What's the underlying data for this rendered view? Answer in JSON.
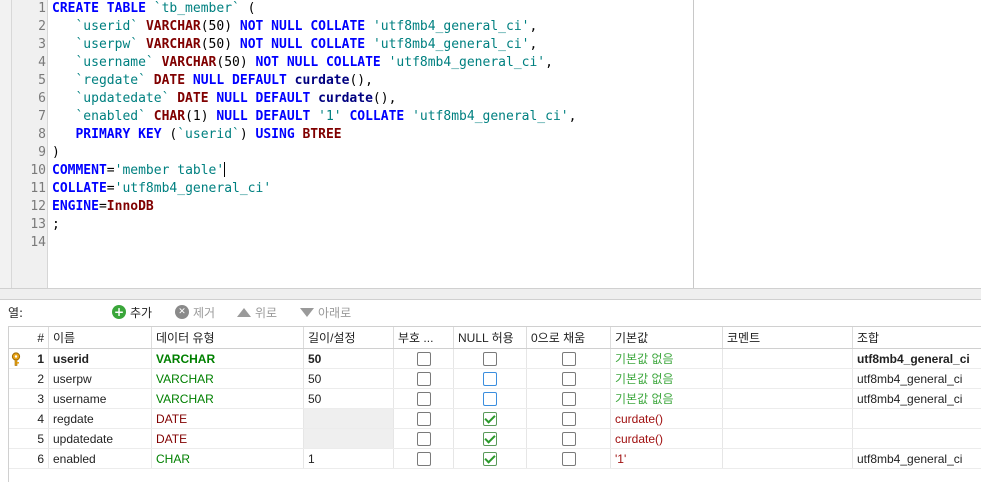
{
  "editor": {
    "line_numbers": [
      "1",
      "2",
      "3",
      "4",
      "5",
      "6",
      "7",
      "8",
      "9",
      "10",
      "11",
      "12",
      "13",
      "14"
    ],
    "lines": [
      [
        [
          "kw",
          "CREATE TABLE "
        ],
        [
          "id",
          "`tb_member`"
        ],
        [
          "pu",
          " ("
        ]
      ],
      [
        [
          "pu",
          "   "
        ],
        [
          "id",
          "`userid`"
        ],
        [
          "pu",
          " "
        ],
        [
          "ty",
          "VARCHAR"
        ],
        [
          "pu",
          "(50) "
        ],
        [
          "kw",
          "NOT NULL COLLATE "
        ],
        [
          "st",
          "'utf8mb4_general_ci'"
        ],
        [
          "pu",
          ","
        ]
      ],
      [
        [
          "pu",
          "   "
        ],
        [
          "id",
          "`userpw`"
        ],
        [
          "pu",
          " "
        ],
        [
          "ty",
          "VARCHAR"
        ],
        [
          "pu",
          "(50) "
        ],
        [
          "kw",
          "NOT NULL COLLATE "
        ],
        [
          "st",
          "'utf8mb4_general_ci'"
        ],
        [
          "pu",
          ","
        ]
      ],
      [
        [
          "pu",
          "   "
        ],
        [
          "id",
          "`username`"
        ],
        [
          "pu",
          " "
        ],
        [
          "ty",
          "VARCHAR"
        ],
        [
          "pu",
          "(50) "
        ],
        [
          "kw",
          "NOT NULL COLLATE "
        ],
        [
          "st",
          "'utf8mb4_general_ci'"
        ],
        [
          "pu",
          ","
        ]
      ],
      [
        [
          "pu",
          "   "
        ],
        [
          "id",
          "`regdate`"
        ],
        [
          "pu",
          " "
        ],
        [
          "ty",
          "DATE"
        ],
        [
          "pu",
          " "
        ],
        [
          "kw",
          "NULL DEFAULT "
        ],
        [
          "fn",
          "curdate"
        ],
        [
          "pu",
          "(),"
        ]
      ],
      [
        [
          "pu",
          "   "
        ],
        [
          "id",
          "`updatedate`"
        ],
        [
          "pu",
          " "
        ],
        [
          "ty",
          "DATE"
        ],
        [
          "pu",
          " "
        ],
        [
          "kw",
          "NULL DEFAULT "
        ],
        [
          "fn",
          "curdate"
        ],
        [
          "pu",
          "(),"
        ]
      ],
      [
        [
          "pu",
          "   "
        ],
        [
          "id",
          "`enabled`"
        ],
        [
          "pu",
          " "
        ],
        [
          "ty",
          "CHAR"
        ],
        [
          "pu",
          "(1) "
        ],
        [
          "kw",
          "NULL DEFAULT "
        ],
        [
          "st",
          "'1'"
        ],
        [
          "pu",
          " "
        ],
        [
          "kw",
          "COLLATE "
        ],
        [
          "st",
          "'utf8mb4_general_ci'"
        ],
        [
          "pu",
          ","
        ]
      ],
      [
        [
          "pu",
          "   "
        ],
        [
          "kw",
          "PRIMARY KEY"
        ],
        [
          "pu",
          " ("
        ],
        [
          "id",
          "`userid`"
        ],
        [
          "pu",
          ") "
        ],
        [
          "kw",
          "USING "
        ],
        [
          "ty",
          "BTREE"
        ]
      ],
      [
        [
          "pu",
          ")"
        ]
      ],
      [
        [
          "kw",
          "COMMENT"
        ],
        [
          "pu",
          "="
        ],
        [
          "st",
          "'member table'"
        ],
        [
          "caret",
          ""
        ]
      ],
      [
        [
          "kw",
          "COLLATE"
        ],
        [
          "pu",
          "="
        ],
        [
          "st",
          "'utf8mb4_general_ci'"
        ]
      ],
      [
        [
          "kw",
          "ENGINE"
        ],
        [
          "pu",
          "="
        ],
        [
          "ty",
          "InnoDB"
        ]
      ],
      [
        [
          "pu",
          ";"
        ]
      ],
      [
        [
          "pu",
          ""
        ]
      ]
    ]
  },
  "toolbar": {
    "columns_label": "열:",
    "add_label": "추가",
    "remove_label": "제거",
    "up_label": "위로",
    "down_label": "아래로"
  },
  "grid": {
    "headers": {
      "num": "#",
      "name": "이름",
      "datatype": "데이터 유형",
      "length": "길이/설정",
      "unsigned": "부호 ...",
      "allow_null": "NULL 허용",
      "zerofill": "0으로 채움",
      "default": "기본값",
      "comment": "코멘트",
      "collation": "조합"
    },
    "rows": [
      {
        "num": "1",
        "name": "userid",
        "type": "VARCHAR",
        "length": "50",
        "unsigned": false,
        "allow_null": false,
        "zerofill": false,
        "default": "기본값 없음",
        "comment": "",
        "collation": "utf8mb4_general_ci",
        "primary_key": true
      },
      {
        "num": "2",
        "name": "userpw",
        "type": "VARCHAR",
        "length": "50",
        "unsigned": false,
        "allow_null": false,
        "zerofill": false,
        "default": "기본값 없음",
        "comment": "",
        "collation": "utf8mb4_general_ci",
        "primary_key": false
      },
      {
        "num": "3",
        "name": "username",
        "type": "VARCHAR",
        "length": "50",
        "unsigned": false,
        "allow_null": false,
        "zerofill": false,
        "default": "기본값 없음",
        "comment": "",
        "collation": "utf8mb4_general_ci",
        "primary_key": false
      },
      {
        "num": "4",
        "name": "regdate",
        "type": "DATE",
        "length": "",
        "unsigned": false,
        "allow_null": true,
        "zerofill": false,
        "default": "curdate()",
        "comment": "",
        "collation": "",
        "primary_key": false
      },
      {
        "num": "5",
        "name": "updatedate",
        "type": "DATE",
        "length": "",
        "unsigned": false,
        "allow_null": true,
        "zerofill": false,
        "default": "curdate()",
        "comment": "",
        "collation": "",
        "primary_key": false
      },
      {
        "num": "6",
        "name": "enabled",
        "type": "CHAR",
        "length": "1",
        "unsigned": false,
        "allow_null": true,
        "zerofill": false,
        "default": "'1'",
        "comment": "",
        "collation": "utf8mb4_general_ci",
        "primary_key": false
      }
    ]
  },
  "colors": {
    "keyword": "#0000ff",
    "type": "#800000",
    "string": "#008080",
    "type_varchar": "#008000",
    "type_date": "#800000",
    "default_none": "#3fa83f",
    "default_value": "#a01010"
  }
}
